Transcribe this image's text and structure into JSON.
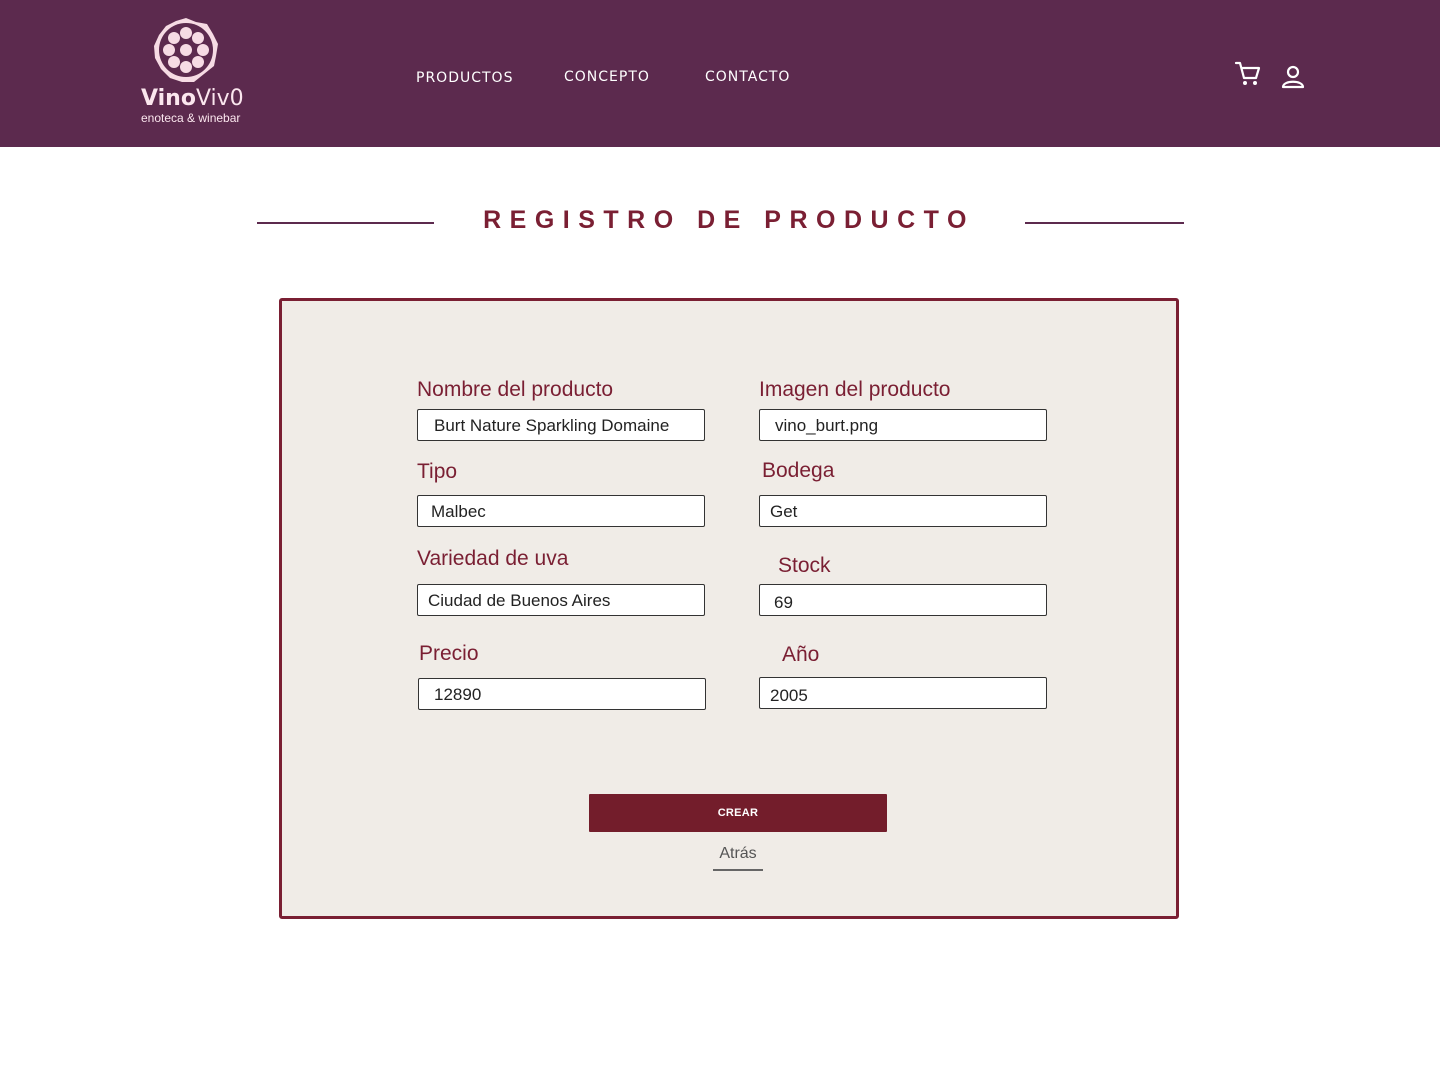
{
  "brand": {
    "name_first": "Vino",
    "name_second": "Viv0",
    "tagline": "enoteca & winebar",
    "colors": {
      "header_bg": "#5c2a4e",
      "accent": "#7a1f33",
      "button": "#731d2b",
      "card_bg": "#f0ece7"
    }
  },
  "nav": {
    "items": [
      {
        "label": "PRODUCTOS"
      },
      {
        "label": "CONCEPTO"
      },
      {
        "label": "CONTACTO"
      }
    ],
    "icons": [
      "cart-icon",
      "user-icon"
    ]
  },
  "page": {
    "title": "REGISTRO DE PRODUCTO"
  },
  "form": {
    "nombre": {
      "label": "Nombre del producto",
      "value": "Burt Nature Sparkling Domaine"
    },
    "imagen": {
      "label": "Imagen del producto",
      "value": "vino_burt.png"
    },
    "tipo": {
      "label": "Tipo",
      "value": "Malbec"
    },
    "bodega": {
      "label": "Bodega",
      "value": "Get"
    },
    "variedad": {
      "label": "Variedad de uva",
      "value": "Ciudad de Buenos Aires"
    },
    "stock": {
      "label": "Stock",
      "value": "69"
    },
    "precio": {
      "label": "Precio",
      "value": "12890"
    },
    "anio": {
      "label": "Año",
      "value": "2005"
    },
    "submit_label": "CREAR",
    "back_label": "Atrás"
  }
}
